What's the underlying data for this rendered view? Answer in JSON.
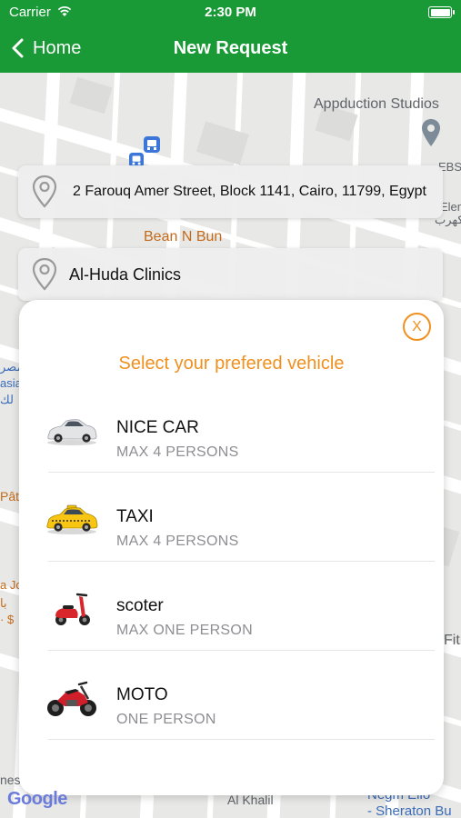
{
  "status_bar": {
    "carrier": "Carrier",
    "time": "2:30 PM"
  },
  "nav": {
    "back_label": "Home",
    "title": "New Request"
  },
  "map": {
    "labels": {
      "studio": "Appduction Studios",
      "ebs": "EBS - E",
      "ebs2": "Eleme",
      "arabic": "الكهرب",
      "bean": "Bean N Bun",
      "left1": "مصر",
      "left2": "asia",
      "left3": "لك",
      "left4": "Pât",
      "left5": "a Jo",
      "left6": "با",
      "left7": "· $",
      "fit": "Fit",
      "nes": "nes",
      "alkhalil": "Al Khalil",
      "neg": "Negm Elio",
      "sheraton": "- Sheraton Bu"
    },
    "google": "Google"
  },
  "pickup": {
    "address": "2 Farouq Amer Street,  Block 1141, Cairo, 11799, Egypt"
  },
  "dropoff": {
    "address": "Al-Huda  Clinics"
  },
  "sheet": {
    "close_label": "X",
    "title": "Select your prefered vehicle",
    "vehicles": [
      {
        "name": "NICE CAR",
        "capacity": "MAX 4 PERSONS",
        "icon": "sedan-car-icon"
      },
      {
        "name": "TAXI",
        "capacity": "MAX 4 PERSONS",
        "icon": "taxi-icon"
      },
      {
        "name": "scoter",
        "capacity": "MAX  ONE PERSON",
        "icon": "scooter-icon"
      },
      {
        "name": "MOTO",
        "capacity": "ONE PERSON",
        "icon": "motorcycle-icon"
      }
    ]
  },
  "colors": {
    "brand": "#1a9a36",
    "accent": "#f0901e"
  }
}
